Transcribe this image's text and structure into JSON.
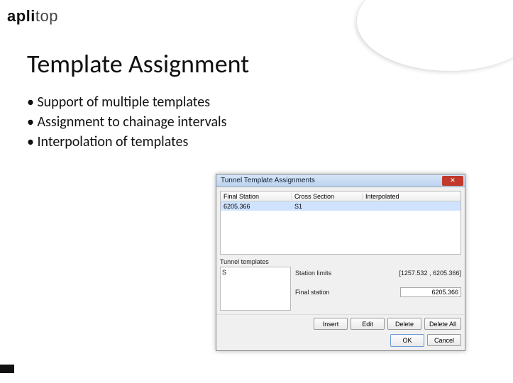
{
  "logo": {
    "brand_bold": "apli",
    "brand_thin": "top"
  },
  "slide": {
    "title": "Template Assignment",
    "bullets": [
      "Support of multiple templates",
      "Assignment to chainage intervals",
      "Interpolation of templates"
    ]
  },
  "dialog": {
    "title": "Tunnel Template Assignments",
    "close_glyph": "✕",
    "table": {
      "headers": {
        "col1": "Final Station",
        "col2": "Cross Section",
        "col3": "Interpolated"
      },
      "row": {
        "col1": "6205.366",
        "col2": "S1",
        "col3": ""
      }
    },
    "templates": {
      "label": "Tunnel templates",
      "item": "S"
    },
    "fields": {
      "station_limits_label": "Station limits",
      "station_limits_value": "[1257.532 , 6205.366]",
      "final_station_label": "Final station",
      "final_station_value": "6205.366"
    },
    "buttons": {
      "insert": "Insert",
      "edit": "Edit",
      "delete": "Delete",
      "delete_all": "Delete All",
      "ok": "OK",
      "cancel": "Cancel"
    }
  }
}
